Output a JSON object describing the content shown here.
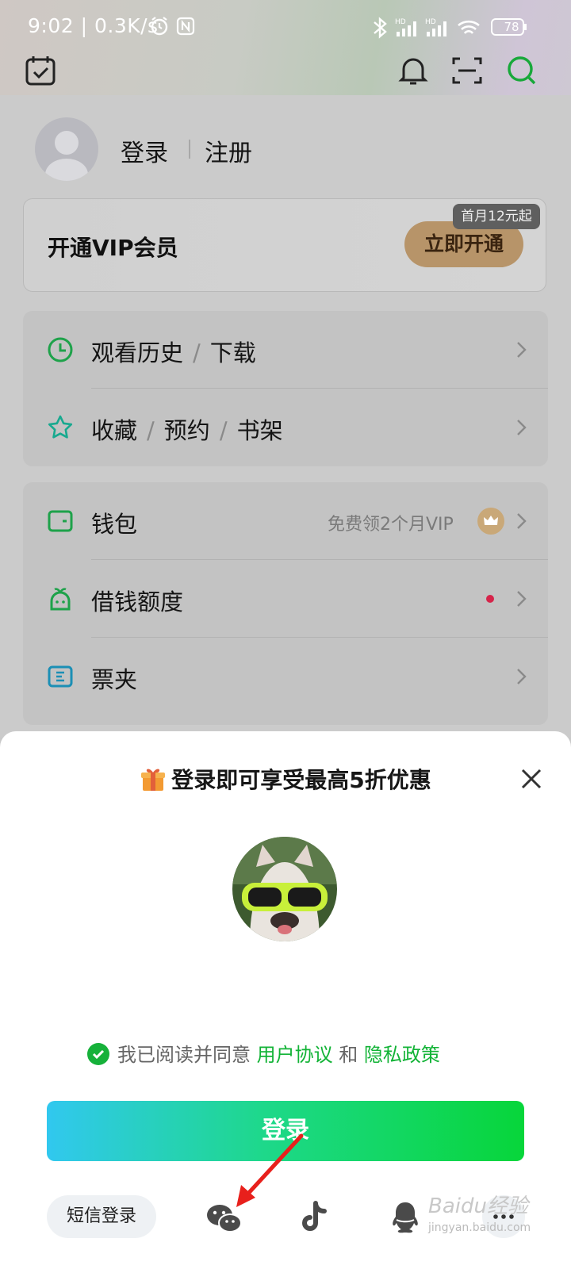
{
  "status_bar": {
    "time": "9:02",
    "speed": "| 0.3K/s",
    "battery": "78"
  },
  "top_icons": [
    "calendar-check-icon",
    "bell-icon",
    "scan-icon",
    "search-icon"
  ],
  "user": {
    "login": "登录",
    "register": "注册"
  },
  "vip": {
    "title": "开通VIP会员",
    "button": "立即开通",
    "badge": "首月12元起"
  },
  "menu1": [
    {
      "parts": [
        "观看历史",
        "下载"
      ],
      "icon": "clock-icon"
    },
    {
      "parts": [
        "收藏",
        "预约",
        "书架"
      ],
      "icon": "star-icon"
    }
  ],
  "menu2": [
    {
      "label": "钱包",
      "extra": "免费领2个月VIP",
      "icon": "wallet-icon"
    },
    {
      "label": "借钱额度",
      "icon": "loan-icon"
    },
    {
      "label": "票夹",
      "icon": "ticket-icon"
    }
  ],
  "sheet": {
    "title": "登录即可享受最高5折优惠",
    "agree_prefix": "我已阅读并同意",
    "agree_link1": "用户协议",
    "agree_and": "和",
    "agree_link2": "隐私政策",
    "login_button": "登录",
    "sms_login": "短信登录",
    "social": [
      "wechat-icon",
      "tiktok-icon",
      "qq-icon",
      "more-icon"
    ]
  },
  "watermark": {
    "main": "Baidu经验",
    "sub": "jingyan.baidu.com"
  },
  "colors": {
    "accent_green": "#12b336",
    "vip_gold": "#b79469",
    "annotation_red": "#e8201c"
  }
}
